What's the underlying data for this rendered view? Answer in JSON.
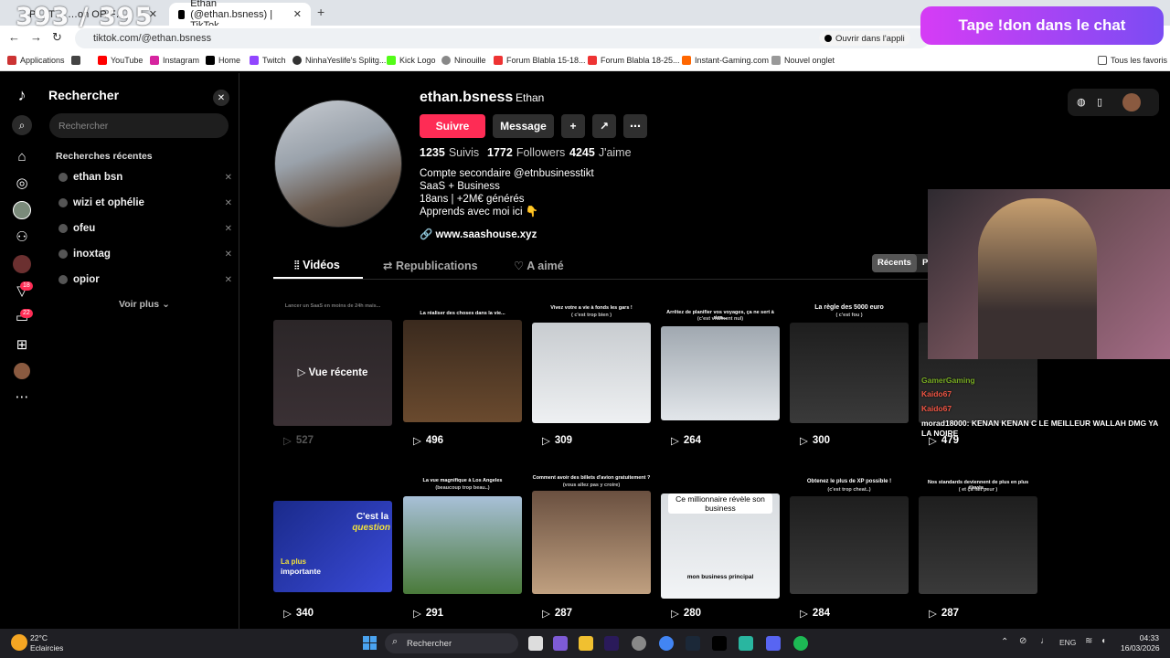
{
  "overlay": {
    "counter": "393 / 395",
    "donation_banner": "Tape !don dans le chat"
  },
  "browser": {
    "tabs": [
      {
        "label": "P… T… …on OR F…"
      },
      {
        "label": "Ethan (@ethan.bsness) | TikTok"
      }
    ],
    "new_tab": "+",
    "url": "tiktok.com/@ethan.bsness",
    "open_in_app": "Ouvrir dans l'appli",
    "bookmarks": [
      "Applications",
      "YouTube",
      "Instagram",
      "Home",
      "Twitch",
      "NinhaYeslife's Splitg...",
      "Kick Logo",
      "Ninouille",
      "Forum Blabla 15-18...",
      "Forum Blabla 18-25...",
      "Instant-Gaming.com",
      "Nouvel onglet"
    ],
    "all_favorites": "Tous les favoris"
  },
  "sidebar": {
    "badges": {
      "inbox": "18",
      "messages": "22"
    },
    "search_title": "Rechercher",
    "search_placeholder": "Rechercher",
    "recent_title": "Recherches récentes",
    "recent": [
      "ethan bsn",
      "wizi et ophélie",
      "ofeu",
      "inoxtag",
      "opior"
    ],
    "see_more": "Voir plus"
  },
  "profile": {
    "username": "ethan.bsness",
    "display_name": "Ethan",
    "follow": "Suivre",
    "message": "Message",
    "following_count": "1235",
    "following_label": "Suivis",
    "followers_count": "1772",
    "followers_label": "Followers",
    "likes_count": "4245",
    "likes_label": "J'aime",
    "bio": [
      "Compte secondaire @etnbusinesstikt",
      "SaaS + Business",
      "18ans | +2M€ générés",
      "Apprends avec moi ici 👇"
    ],
    "link": "www.saashouse.xyz",
    "tabs": [
      "Vidéos",
      "Republications",
      "A aimé"
    ],
    "sort": [
      "Récents",
      "Po"
    ]
  },
  "videos": [
    {
      "views": "527",
      "caption": "Lancer un SaaS en moins de 24h mais...",
      "overlay": "Vue récente"
    },
    {
      "views": "496",
      "caption": "La réaliser des choses dans la vie..."
    },
    {
      "views": "309",
      "caption": "Vivez votre a vie à fonds les gars !",
      "sub": "( c'est trop bien )"
    },
    {
      "views": "264",
      "caption": "Arrêtez de planifier vos voyages, ça ne sert à rien...",
      "sub": "(c'est vraiment nul)"
    },
    {
      "views": "300",
      "caption": "La règle des 5000 euro",
      "sub": "( c'est fou )"
    },
    {
      "views": "479",
      "caption": ""
    },
    {
      "views": "340",
      "caption": "",
      "text": [
        "C'est la",
        "question",
        "La plus",
        "importante"
      ]
    },
    {
      "views": "291",
      "caption": "La vue magnifique à Los Angeles",
      "sub": "(beaucoup trop beau..)"
    },
    {
      "views": "287",
      "caption": "Comment avoir des billets d'avion gratuitement ?",
      "sub": "(vous allez pas y croire)"
    },
    {
      "views": "280",
      "caption": "",
      "text": [
        "Ce millionnaire révèle son business",
        "mon business principal"
      ]
    },
    {
      "views": "284",
      "caption": "Obtenez le plus de XP possible !",
      "sub": "(c'est trop cheat..)"
    },
    {
      "views": "287",
      "caption": "Nos standards deviennent de plus en plus élevés...",
      "sub": "( et ça fait peur )"
    }
  ],
  "chat": [
    {
      "user": "GamerGaming",
      "msg": ""
    },
    {
      "user": "Kaido67",
      "msg": ""
    },
    {
      "user": "Kaido67",
      "msg": ""
    },
    {
      "user": "morad18000",
      "msg": ": KENAN KENAN C LE MEILLEUR WALLAH DMG YA LA NOIRE"
    }
  ],
  "taskbar": {
    "weather_temp": "22°C",
    "weather_desc": "Eclaircies",
    "search": "Rechercher",
    "lang": "ENG",
    "time": "04:33",
    "date": "16/03/2026"
  },
  "colors": {
    "accent": "#fe2c55",
    "tiktok_bg": "#000000",
    "donation_gradient": "#c03cf4"
  }
}
